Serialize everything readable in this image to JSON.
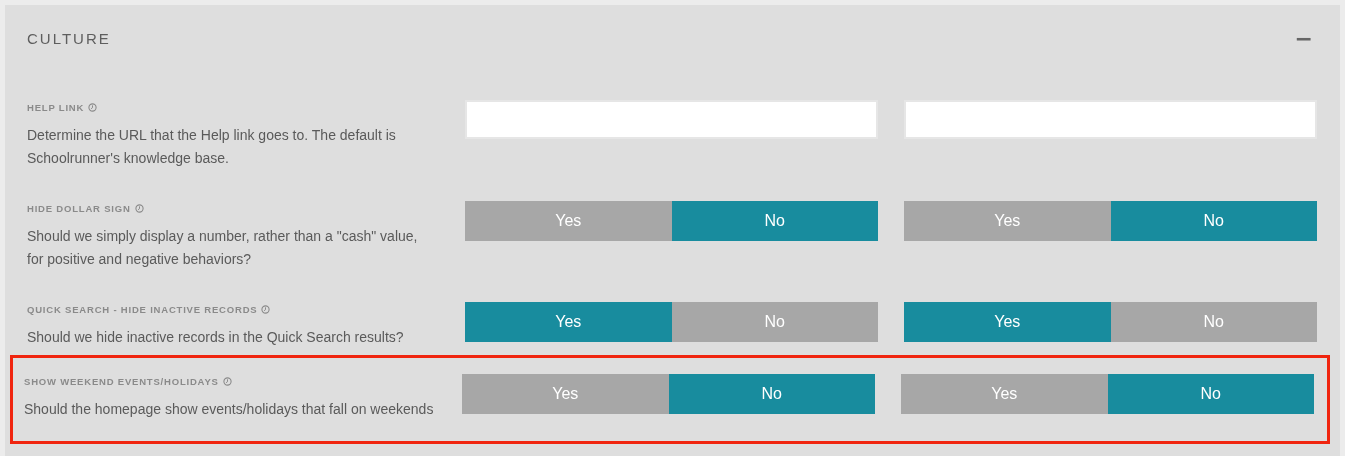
{
  "section": {
    "title": "CULTURE",
    "collapse_symbol": "−"
  },
  "settings": [
    {
      "label": "HELP LINK",
      "description": "Determine the URL that the Help link goes to. The default is Schoolrunner's knowledge base.",
      "highlighted": false,
      "controls": [
        {
          "kind": "input"
        },
        {
          "kind": "input"
        }
      ]
    },
    {
      "label": "HIDE DOLLAR SIGN",
      "description": "Should we simply display a number, rather than a \"cash\" value, for positive and negative behaviors?",
      "highlighted": false,
      "controls": [
        {
          "kind": "toggle",
          "options": [
            {
              "label": "Yes",
              "selected": false
            },
            {
              "label": "No",
              "selected": true
            }
          ]
        },
        {
          "kind": "toggle",
          "options": [
            {
              "label": "Yes",
              "selected": false
            },
            {
              "label": "No",
              "selected": true
            }
          ]
        }
      ]
    },
    {
      "label": "QUICK SEARCH - HIDE INACTIVE RECORDS",
      "description": "Should we hide inactive records in the Quick Search results?",
      "highlighted": false,
      "controls": [
        {
          "kind": "toggle",
          "options": [
            {
              "label": "Yes",
              "selected": true
            },
            {
              "label": "No",
              "selected": false
            }
          ]
        },
        {
          "kind": "toggle",
          "options": [
            {
              "label": "Yes",
              "selected": true
            },
            {
              "label": "No",
              "selected": false
            }
          ]
        }
      ]
    },
    {
      "label": "SHOW WEEKEND EVENTS/HOLIDAYS",
      "description": "Should the homepage show events/holidays that fall on weekends",
      "highlighted": true,
      "controls": [
        {
          "kind": "toggle",
          "options": [
            {
              "label": "Yes",
              "selected": false
            },
            {
              "label": "No",
              "selected": true
            }
          ]
        },
        {
          "kind": "toggle",
          "options": [
            {
              "label": "Yes",
              "selected": false
            },
            {
              "label": "No",
              "selected": true
            }
          ]
        }
      ]
    }
  ]
}
